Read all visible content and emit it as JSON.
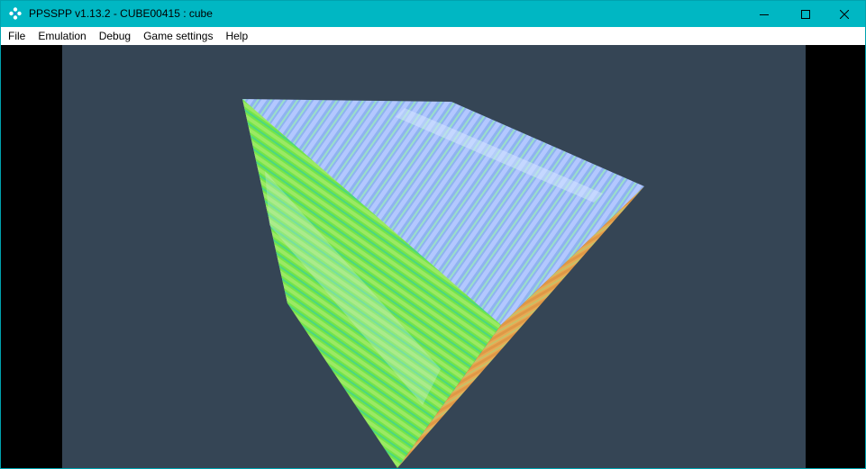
{
  "window": {
    "title": "PPSSPP v1.13.2 - CUBE00415 : cube",
    "frame_color": "#00b7c3"
  },
  "titlebar_buttons": {
    "minimize_icon": "minimize-icon",
    "maximize_icon": "maximize-icon",
    "close_icon": "close-icon"
  },
  "menu": {
    "items": [
      "File",
      "Emulation",
      "Debug",
      "Game settings",
      "Help"
    ]
  },
  "game": {
    "background_color": "#354555",
    "letterbox_color": "#000000",
    "scene": "rotating textured cube"
  }
}
